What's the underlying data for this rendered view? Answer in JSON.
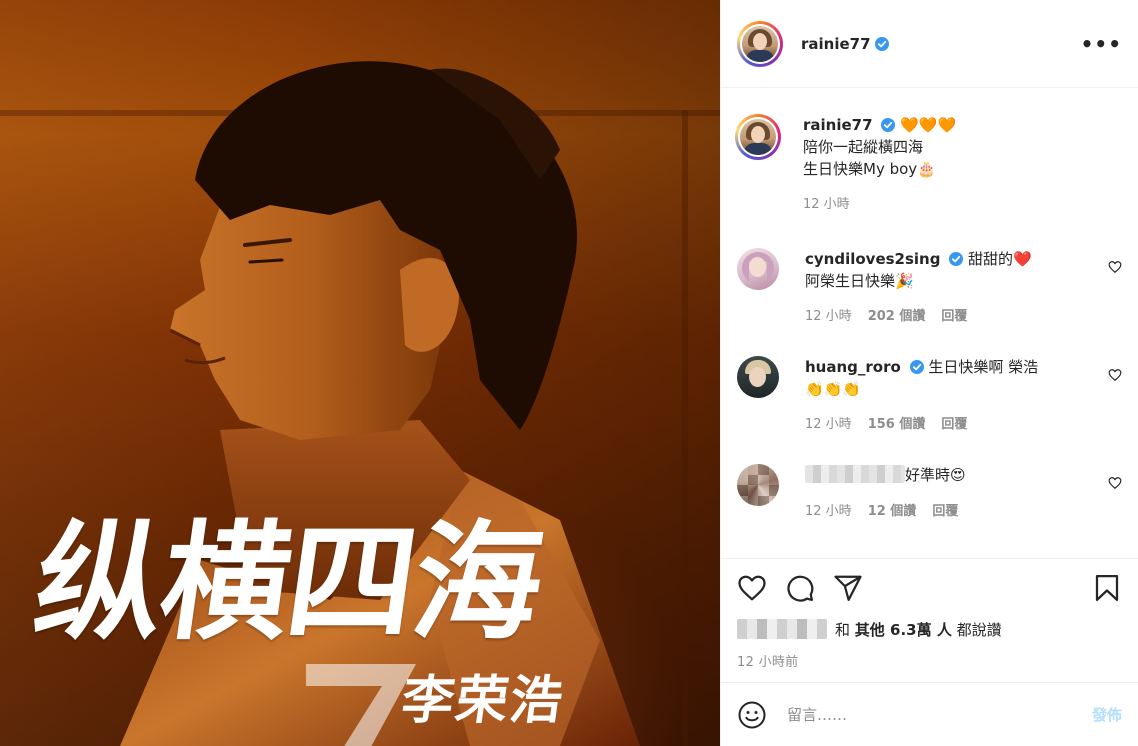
{
  "post": {
    "author": "rainie77",
    "more_label": "•••"
  },
  "image": {
    "title_cn": "纵横四海",
    "seven": "7",
    "artist_cn": "李荣浩"
  },
  "caption": {
    "username": "rainie77",
    "hearts": "🧡🧡🧡",
    "line1": "陪你一起縱橫四海",
    "line2": "生日快樂My boy🎂",
    "time": "12 小時"
  },
  "comments": [
    {
      "username": "cyndiloves2sing",
      "text1": "甜甜的❤️",
      "text2": "阿榮生日快樂🎉",
      "time": "12 小時",
      "likes": "202 個讚",
      "reply": "回覆"
    },
    {
      "username": "huang_roro",
      "text1": "生日快樂啊 榮浩",
      "text2": "👏👏👏",
      "time": "12 小時",
      "likes": "156 個讚",
      "reply": "回覆"
    },
    {
      "username": "",
      "text1": "好準時😍",
      "text2": "",
      "time": "12 小時",
      "likes": "12 個讚",
      "reply": "回覆"
    }
  ],
  "likes_summary": {
    "and_label": "和",
    "others": "其他 6.3萬 人",
    "suffix": "都說讚"
  },
  "post_time": "12 小時前",
  "composer": {
    "placeholder": "留言……",
    "post_label": "發佈"
  },
  "colors": {
    "verified": "#3897f0",
    "heart": "#ff6b1a",
    "post_button": "#b2dffc"
  }
}
